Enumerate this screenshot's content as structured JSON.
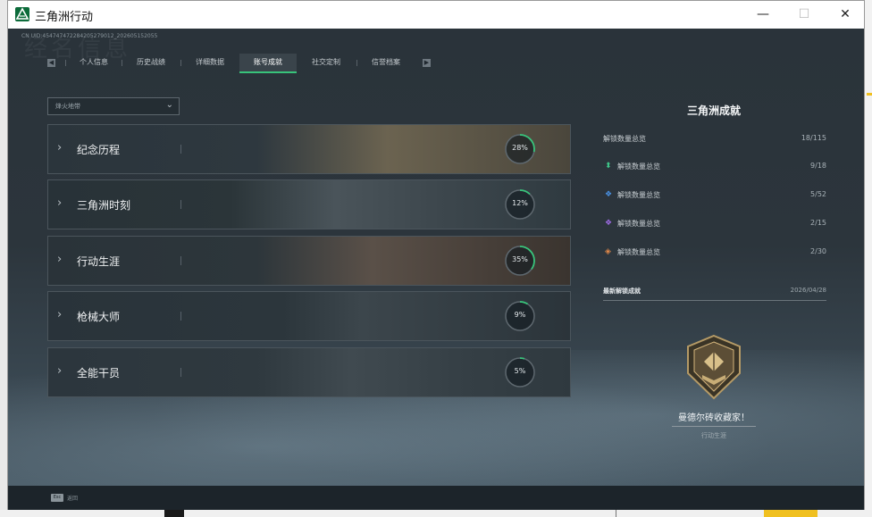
{
  "window": {
    "title": "三角洲行动",
    "controls": {
      "minimize": "—",
      "maximize": "☐",
      "close": "✕"
    }
  },
  "header": {
    "uid": "CN UID:454747472284205279012_202605152055",
    "bg_title": "经名信息"
  },
  "tabs": [
    {
      "label": "个人信息",
      "active": false
    },
    {
      "label": "历史战绩",
      "active": false
    },
    {
      "label": "详细数据",
      "active": false
    },
    {
      "label": "账号成就",
      "active": true
    },
    {
      "label": "社交定制",
      "active": false
    },
    {
      "label": "信誉档案",
      "active": false
    }
  ],
  "tab_arrows": {
    "left": "◀",
    "right": "▶"
  },
  "filter": {
    "label": "烽火地带"
  },
  "categories": [
    {
      "name": "纪念历程",
      "percent_text": "28%",
      "progress": 0.28
    },
    {
      "name": "三角洲时刻",
      "percent_text": "12%",
      "progress": 0.12
    },
    {
      "name": "行动生涯",
      "percent_text": "35%",
      "progress": 0.35
    },
    {
      "name": "枪械大师",
      "percent_text": "9%",
      "progress": 0.09
    },
    {
      "name": "全能干员",
      "percent_text": "5%",
      "progress": 0.05
    }
  ],
  "sidebar": {
    "title": "三角洲成就",
    "total": {
      "label": "解锁数量总览",
      "value": "18/115"
    },
    "tiers": [
      {
        "label": "解锁数量总览",
        "value": "9/18",
        "icon": "green-tier-icon",
        "color": "#3fc78a"
      },
      {
        "label": "解锁数量总览",
        "value": "5/52",
        "icon": "blue-tier-icon",
        "color": "#4a90e2"
      },
      {
        "label": "解锁数量总览",
        "value": "2/15",
        "icon": "purple-tier-icon",
        "color": "#9b6ae0"
      },
      {
        "label": "解锁数量总览",
        "value": "2/30",
        "icon": "orange-tier-icon",
        "color": "#e0884a"
      }
    ],
    "recent_label": "最新解锁成就",
    "recent_date": "2026/04/28",
    "achievement": {
      "name": "曼德尔砖收藏家！",
      "category": "行动生涯"
    }
  },
  "footer": {
    "esc_key": "Esc",
    "esc_label": "返回"
  },
  "colors": {
    "accent": "#38c37a",
    "background": "#1d252c"
  }
}
